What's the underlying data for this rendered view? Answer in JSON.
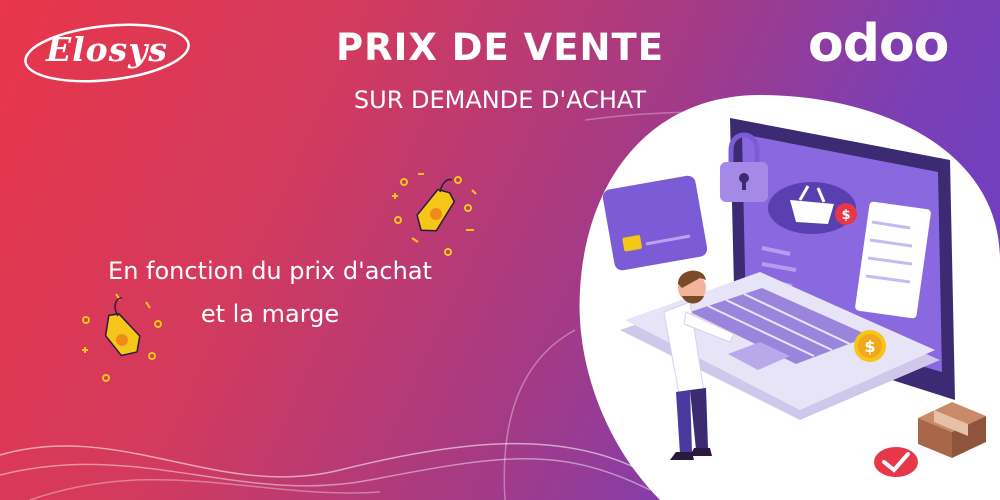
{
  "brand": {
    "left_logo": "Elosys",
    "right_logo": "odoo"
  },
  "title": {
    "line1": "PRIX DE VENTE",
    "line2": "SUR DEMANDE D'ACHAT"
  },
  "subtitle": {
    "line1": "En fonction du prix d'achat",
    "line2": "et la marge"
  },
  "illustration": {
    "badge_symbol": "$"
  },
  "colors": {
    "gradient_start": "#e8364a",
    "gradient_end": "#6a3fc6",
    "accent_yellow": "#f5c518",
    "screen_purple": "#7c5bd6"
  },
  "icons": [
    "price-tag-icon",
    "lock-icon",
    "shopping-basket-icon",
    "credit-card-icon",
    "dollar-coin-icon",
    "package-box-icon",
    "checkmark-badge-icon"
  ]
}
